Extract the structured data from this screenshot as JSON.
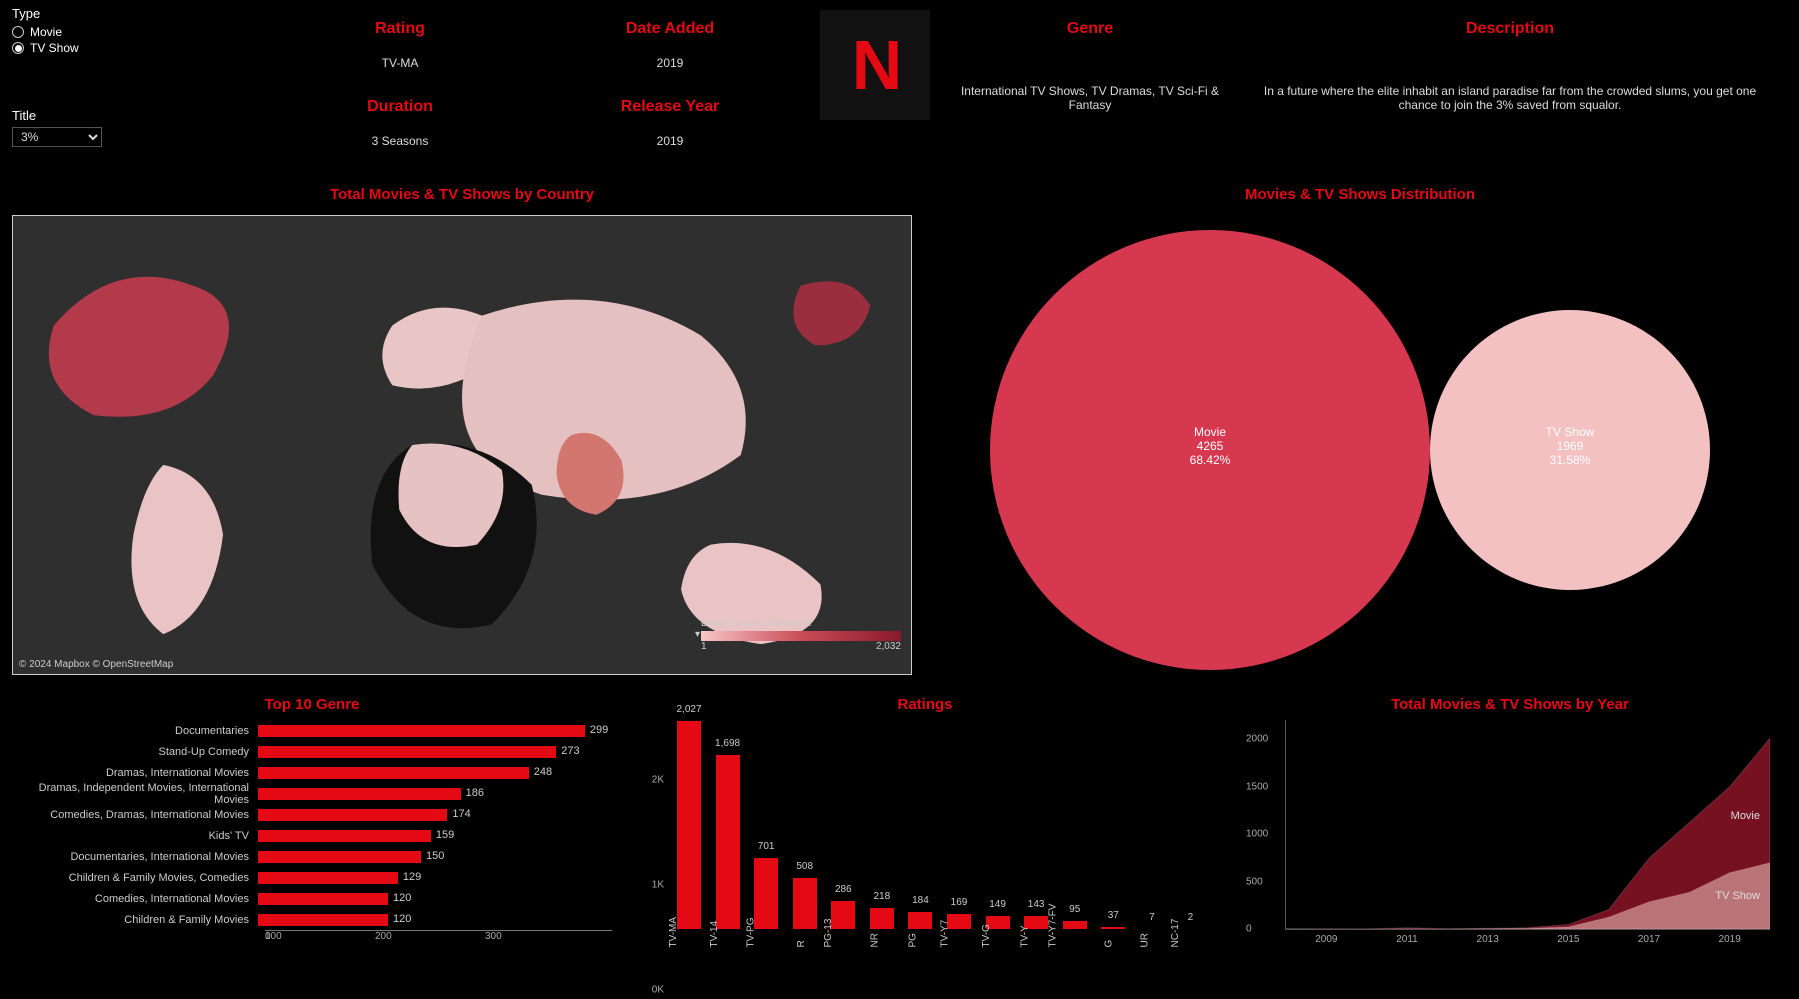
{
  "filters": {
    "type_label": "Type",
    "type_options": [
      "Movie",
      "TV Show"
    ],
    "type_selected": "TV Show",
    "title_label": "Title",
    "title_value": "3%"
  },
  "info": {
    "rating_label": "Rating",
    "rating_value": "TV-MA",
    "date_added_label": "Date Added",
    "date_added_value": "2019",
    "duration_label": "Duration",
    "duration_value": "3 Seasons",
    "release_year_label": "Release Year",
    "release_year_value": "2019",
    "genre_label": "Genre",
    "genre_value": "International TV Shows, TV Dramas, TV Sci-Fi & Fantasy",
    "description_label": "Description",
    "description_value": "In a future where the elite inhabit an island paradise far from the crowded slums, you get one chance to join the 3% saved from squalor."
  },
  "logo_letter": "N",
  "sections": {
    "map_title": "Total Movies & TV Shows by Country",
    "distribution_title": "Movies & TV Shows Distribution",
    "top_genre_title": "Top 10 Genre",
    "ratings_title": "Ratings",
    "year_title": "Total Movies & TV Shows by Year"
  },
  "map": {
    "attribution": "© 2024 Mapbox © OpenStreetMap",
    "legend_title": "Distinct count of Show Id",
    "legend_min": "1",
    "legend_max": "2,032"
  },
  "chart_data": [
    {
      "type": "pie",
      "id": "distribution",
      "title": "Movies & TV Shows Distribution",
      "series": [
        {
          "name": "Movie",
          "value": 4265,
          "percent": "68.42%",
          "color": "#d6384f"
        },
        {
          "name": "TV Show",
          "value": 1969,
          "percent": "31.58%",
          "color": "#f3c1c1"
        }
      ]
    },
    {
      "type": "bar",
      "id": "top_genre",
      "title": "Top 10 Genre",
      "orientation": "horizontal",
      "xlim": [
        0,
        300
      ],
      "xticks": [
        0,
        100,
        200,
        300
      ],
      "categories": [
        "Documentaries",
        "Stand-Up Comedy",
        "Dramas, International Movies",
        "Dramas, Independent Movies, International Movies",
        "Comedies, Dramas, International Movies",
        "Kids' TV",
        "Documentaries, International Movies",
        "Children & Family Movies, Comedies",
        "Comedies, International Movies",
        "Children & Family Movies"
      ],
      "values": [
        299,
        273,
        248,
        186,
        174,
        159,
        150,
        129,
        120,
        120
      ]
    },
    {
      "type": "bar",
      "id": "ratings",
      "title": "Ratings",
      "ylim": [
        0,
        2027
      ],
      "yticks": [
        "0K",
        "1K",
        "2K"
      ],
      "categories": [
        "TV-MA",
        "TV-14",
        "TV-PG",
        "R",
        "PG-13",
        "NR",
        "PG",
        "TV-Y7",
        "TV-G",
        "TV-Y",
        "TV-Y7-FV",
        "G",
        "UR",
        "NC-17"
      ],
      "values": [
        2027,
        1698,
        701,
        508,
        286,
        218,
        184,
        169,
        149,
        143,
        95,
        37,
        7,
        2
      ]
    },
    {
      "type": "area",
      "id": "by_year",
      "title": "Total Movies & TV Shows by Year",
      "x": [
        2008,
        2009,
        2010,
        2011,
        2012,
        2013,
        2014,
        2015,
        2016,
        2017,
        2018,
        2019,
        2020
      ],
      "xticks": [
        2009,
        2011,
        2013,
        2015,
        2017,
        2019
      ],
      "ylim": [
        0,
        2200
      ],
      "yticks": [
        0,
        500,
        1000,
        1500,
        2000
      ],
      "series": [
        {
          "name": "Movie",
          "color": "rgba(139,20,40,0.85)",
          "values": [
            1,
            2,
            1,
            13,
            4,
            6,
            14,
            48,
            204,
            744,
            1121,
            1497,
            2009
          ]
        },
        {
          "name": "TV Show",
          "color": "rgba(210,150,150,0.75)",
          "values": [
            1,
            0,
            0,
            0,
            0,
            4,
            6,
            23,
            124,
            286,
            386,
            592,
            697
          ]
        }
      ]
    }
  ]
}
